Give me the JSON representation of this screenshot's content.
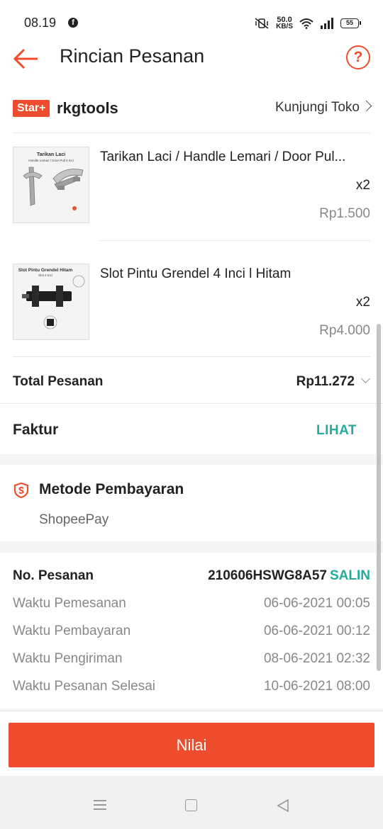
{
  "status_bar": {
    "time": "08.19",
    "network_speed_value": "50.0",
    "network_speed_unit": "KB/S",
    "battery": "55"
  },
  "header": {
    "title": "Rincian Pesanan"
  },
  "shop": {
    "badge": "Star+",
    "name": "rkgtools",
    "visit_label": "Kunjungi Toko"
  },
  "products": [
    {
      "name": "Tarikan Laci / Handle Lemari / Door Pul...",
      "qty": "x2",
      "price": "Rp1.500",
      "thumb_title": "Tarikan Laci",
      "thumb_subtitle": "Handle Lemari / Door Pull 4 Inci"
    },
    {
      "name": "Slot Pintu Grendel 4 Inci l Hitam",
      "qty": "x2",
      "price": "Rp4.000",
      "thumb_title": "Slot Pintu Grendel Hitam",
      "thumb_subtitle": "Slot 4 Inci"
    }
  ],
  "order_total": {
    "label": "Total Pesanan",
    "value": "Rp11.272"
  },
  "invoice": {
    "label": "Faktur",
    "action": "LIHAT"
  },
  "payment": {
    "title": "Metode Pembayaran",
    "method": "ShopeePay"
  },
  "order_info": {
    "number_label": "No. Pesanan",
    "number_value": "210606HSWG8A57",
    "copy_label": "SALIN",
    "rows": [
      {
        "label": "Waktu Pemesanan",
        "value": "06-06-2021 00:05"
      },
      {
        "label": "Waktu Pembayaran",
        "value": "06-06-2021 00:12"
      },
      {
        "label": "Waktu Pengiriman",
        "value": "08-06-2021 02:32"
      },
      {
        "label": "Waktu Pesanan Selesai",
        "value": "10-06-2021 08:00"
      }
    ]
  },
  "action_button": {
    "label": "Nilai"
  },
  "colors": {
    "brand": "#ee4d2d",
    "link_teal": "#26aa99"
  }
}
